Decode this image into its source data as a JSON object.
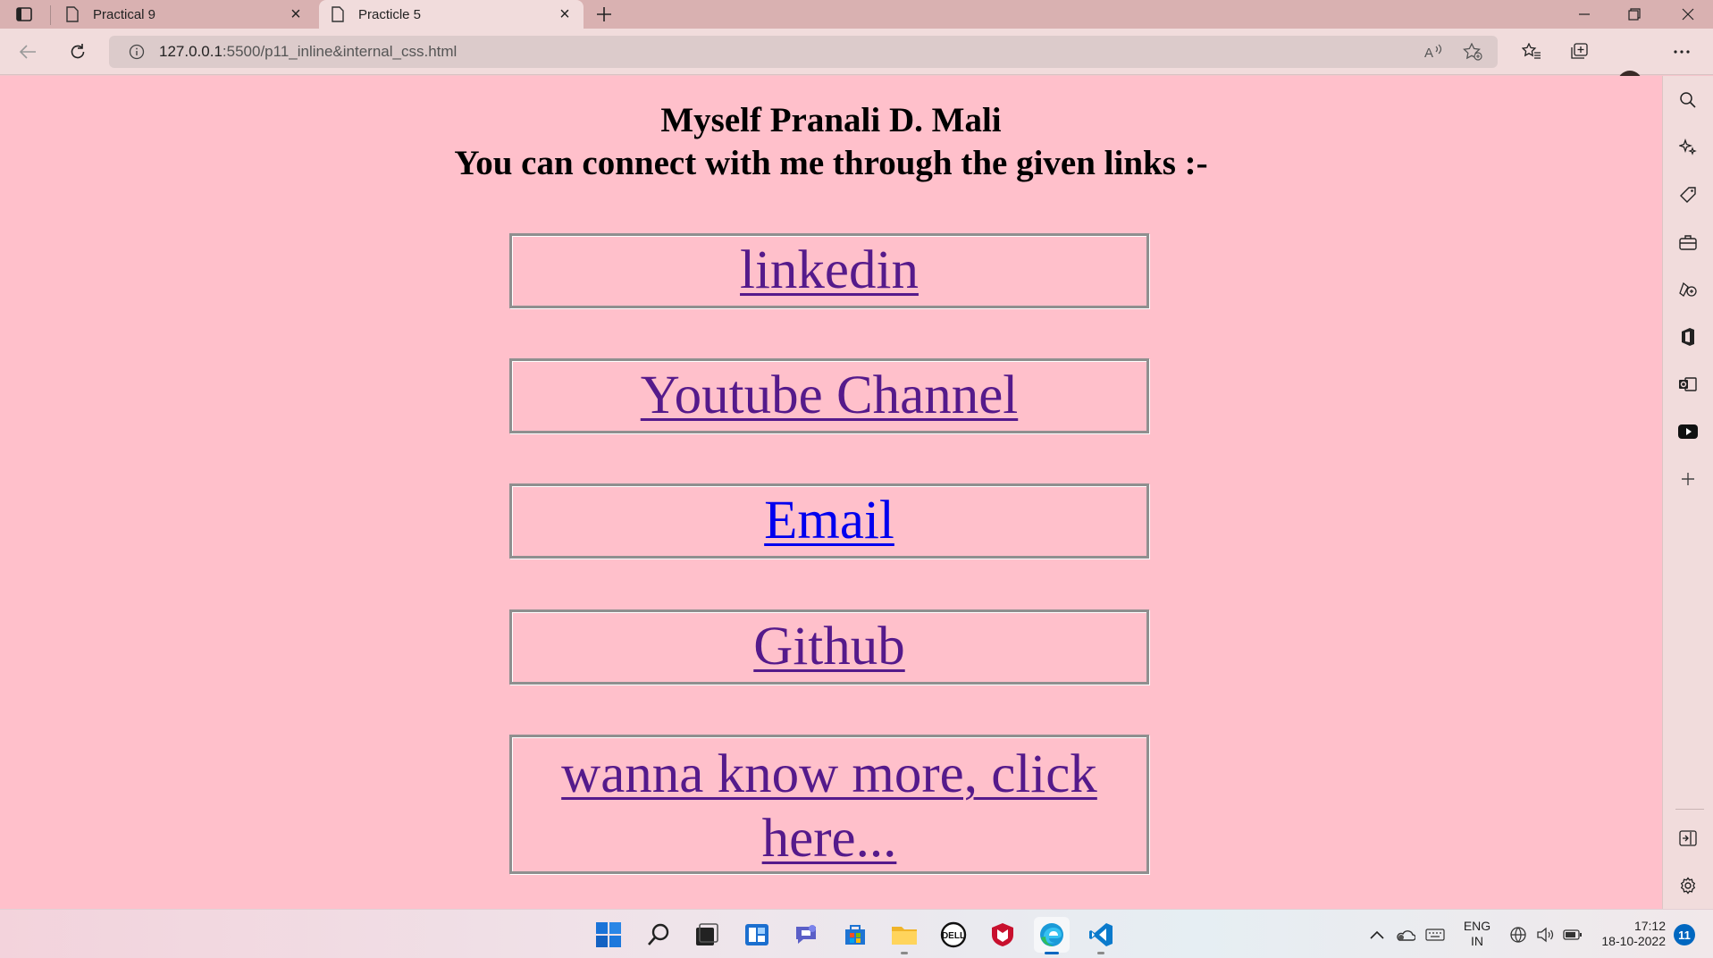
{
  "browser": {
    "tabs": [
      {
        "label": "Practical 9",
        "icon": "document-icon"
      },
      {
        "label": "Practicle 5",
        "icon": "document-icon"
      }
    ],
    "url_host": "127.0.0.1",
    "url_path": ":5500/p11_inline&internal_css.html",
    "accent": "#d9b1b1"
  },
  "page": {
    "background": "#ffc0cb",
    "heading_line1": "Myself Pranali D. Mali",
    "heading_line2": "You can connect with me through the given links :-",
    "links": [
      {
        "label": "linkedin",
        "visited": true
      },
      {
        "label": "Youtube Channel",
        "visited": true
      },
      {
        "label": "Email",
        "visited": false
      },
      {
        "label": "Github",
        "visited": true
      },
      {
        "label": "wanna know more, click here...",
        "visited": true
      }
    ]
  },
  "sidebar": {
    "icons": [
      "search-icon",
      "sparkle-icon",
      "tag-icon",
      "briefcase-icon",
      "games-icon",
      "office-icon",
      "outlook-icon",
      "youtube-icon",
      "add-icon"
    ],
    "bottom_icons": [
      "sidebar-collapse-icon",
      "settings-icon"
    ]
  },
  "taskbar": {
    "apps": [
      "start-icon",
      "search-icon",
      "task-view-icon",
      "widgets-icon",
      "chat-icon",
      "store-icon",
      "file-explorer-icon",
      "dell-icon",
      "mcafee-icon",
      "edge-icon",
      "vscode-icon"
    ],
    "lang_line1": "ENG",
    "lang_line2": "IN",
    "time": "17:12",
    "date": "18-10-2022",
    "notifications": "11"
  }
}
